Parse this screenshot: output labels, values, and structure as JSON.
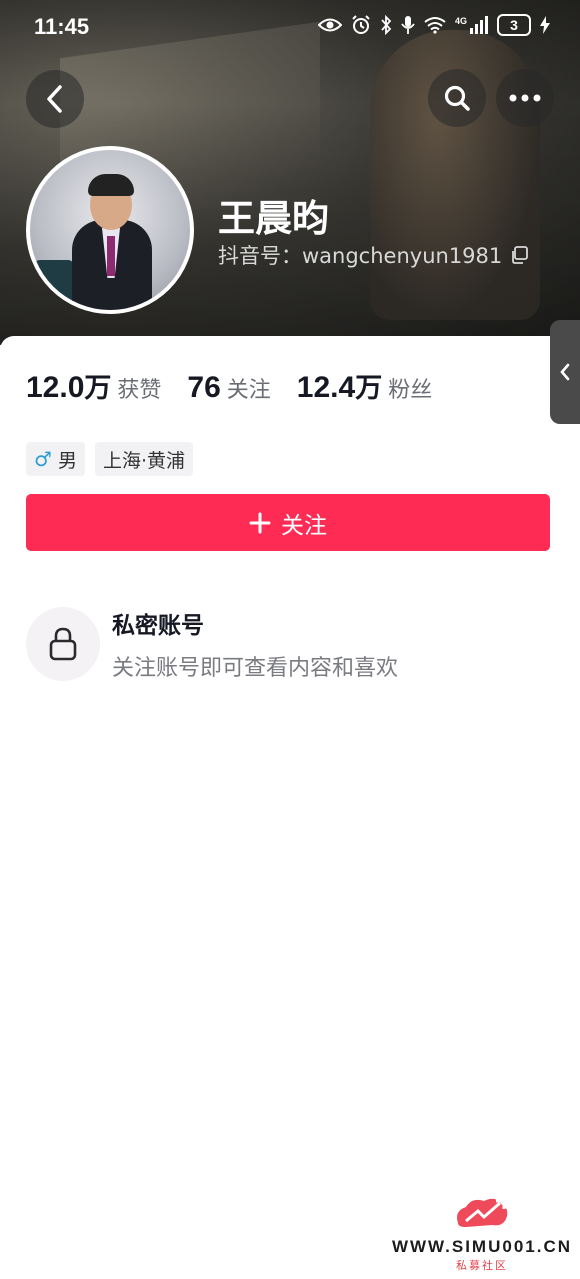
{
  "status_bar": {
    "time": "11:45",
    "network": "4G",
    "battery": "3"
  },
  "profile": {
    "name": "王晨昀",
    "id_label": "抖音号：",
    "id_value": "wangchenyun1981"
  },
  "stats": [
    {
      "value": "12.0",
      "unit": "万",
      "label": "获赞"
    },
    {
      "value": "76",
      "unit": "",
      "label": "关注"
    },
    {
      "value": "12.4",
      "unit": "万",
      "label": "粉丝"
    }
  ],
  "tags": {
    "gender_symbol": "♂",
    "gender": "男",
    "location": "上海·黄浦"
  },
  "follow_button": {
    "label": "关注",
    "color": "#fe2c55"
  },
  "private": {
    "title": "私密账号",
    "description": "关注账号即可查看内容和喜欢"
  },
  "watermark": {
    "site": "WWW.SIMU001.CN",
    "sub": "私募社区"
  },
  "icons": [
    "back-icon",
    "search-icon",
    "more-icon",
    "copy-icon",
    "lock-icon",
    "plus-icon",
    "chevron-left-icon",
    "eye-icon",
    "alarm-icon",
    "bluetooth-icon",
    "mic-icon",
    "wifi-icon",
    "signal-icon",
    "charging-icon"
  ]
}
